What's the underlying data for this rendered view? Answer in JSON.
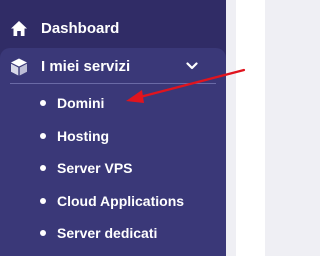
{
  "sidebar": {
    "dashboard": {
      "label": "Dashboard",
      "icon": "home-icon"
    },
    "group": {
      "label": "I miei servizi",
      "icon": "box-icon",
      "expanded": true,
      "items": [
        {
          "label": "Domini"
        },
        {
          "label": "Hosting"
        },
        {
          "label": "Server VPS"
        },
        {
          "label": "Cloud Applications"
        },
        {
          "label": "Server dedicati"
        }
      ]
    }
  },
  "annotation": {
    "icon": "red-arrow-icon",
    "color": "#e0141e"
  },
  "colors": {
    "sidebar": "#302c66",
    "group": "#3a3878",
    "text": "#ffffff"
  }
}
